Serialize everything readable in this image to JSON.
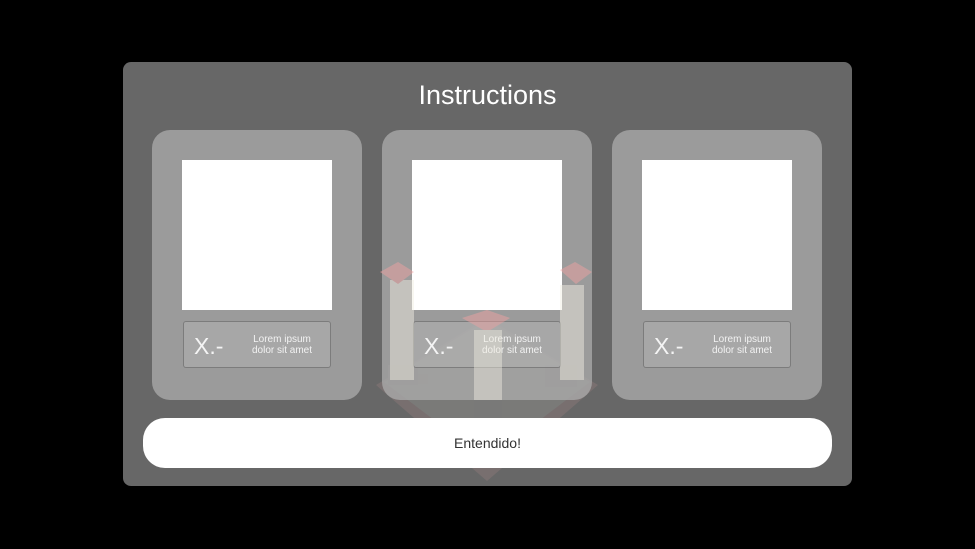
{
  "instructions_dialog": {
    "title": "Instructions",
    "cards": [
      {
        "number": "X.-",
        "text": "Lorem ipsum dolor sit amet"
      },
      {
        "number": "X.-",
        "text": "Lorem ipsum dolor sit amet"
      },
      {
        "number": "X.-",
        "text": "Lorem ipsum dolor sit amet"
      }
    ],
    "confirm_label": "Entendido!"
  },
  "colors": {
    "background": "#000000",
    "panel": "#707070",
    "card": "#aaaaaa",
    "pillar_cap": "#e88a8a",
    "pillar_body": "#e8e4d4",
    "base_edge": "#d96a6a"
  },
  "scene": {
    "object": "game-board-with-pillars"
  }
}
